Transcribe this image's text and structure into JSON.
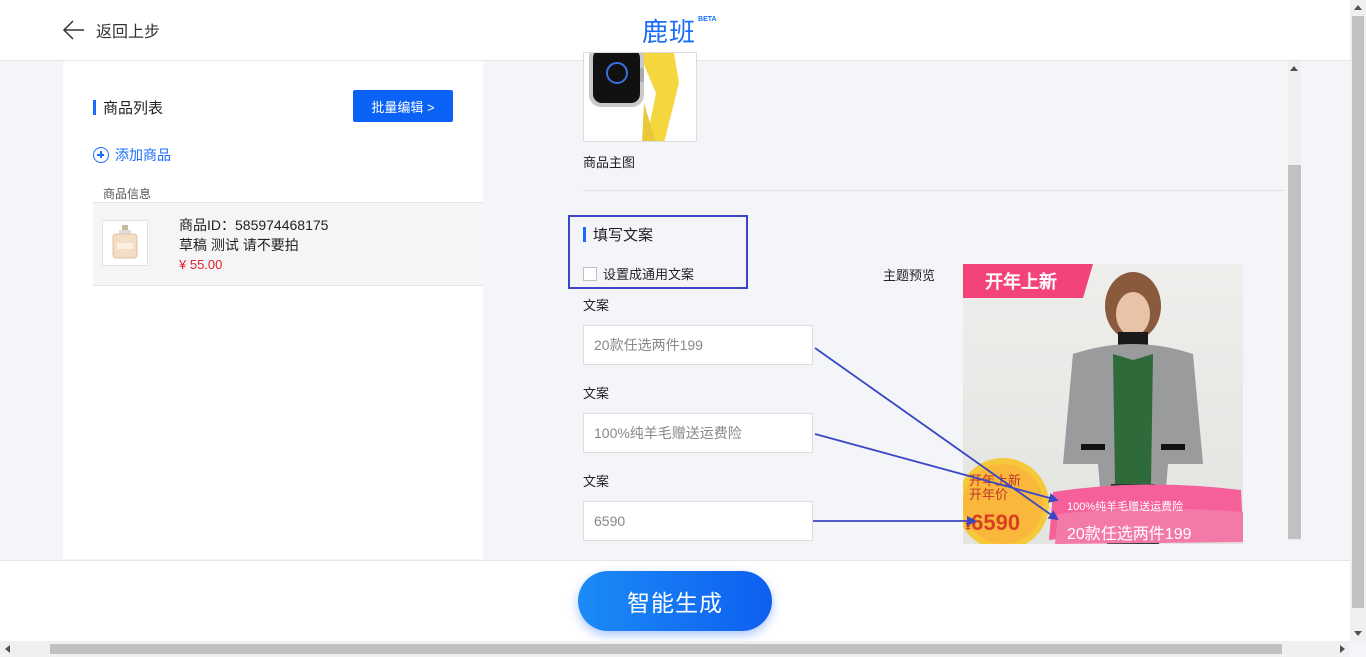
{
  "header": {
    "back_label": "返回上步",
    "logo": "鹿班",
    "logo_badge": "BETA"
  },
  "left": {
    "title": "商品列表",
    "batch_edit_label": "批量编辑 >",
    "add_product_label": "添加商品",
    "info_header": "商品信息",
    "product": {
      "id_line": "商品ID：585974468175",
      "name": "草稿 测试 请不要拍",
      "price": "¥ 55.00"
    }
  },
  "right": {
    "main_image_label": "商品主图",
    "copy_section_title": "填写文案",
    "checkbox_label": "设置成通用文案",
    "fields": [
      {
        "label": "文案",
        "value": "20款任选两件199"
      },
      {
        "label": "文案",
        "value": "100%纯羊毛赠送运费险"
      },
      {
        "label": "文案",
        "value": "6590"
      }
    ],
    "preview_label": "主题预览",
    "preview": {
      "banner": "开年上新",
      "badge_line1": "开年上新",
      "badge_line2": "开年价",
      "price_symbol": "¥",
      "price": "6590",
      "line1": "100%纯羊毛赠送运费险",
      "line2": "20款任选两件199"
    }
  },
  "bottom": {
    "generate_label": "智能生成"
  },
  "colors": {
    "brand_blue": "#1a6dfa",
    "price_red": "#e4202a",
    "highlight_box": "#3b46c4",
    "annotation_arrow": "#3b46c4"
  }
}
